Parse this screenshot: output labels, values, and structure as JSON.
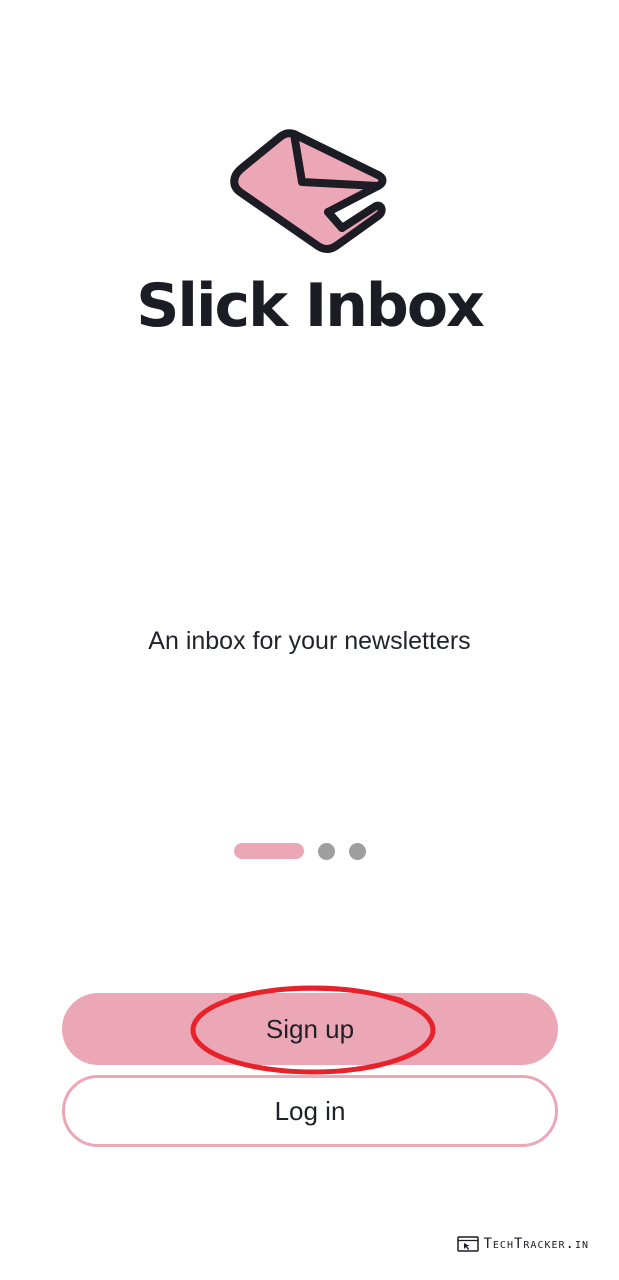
{
  "brand": {
    "name": "Slick Inbox",
    "logo_icon": "envelope-newspaper-icon",
    "logo_fill": "#eca7b6",
    "logo_stroke": "#1c1c24"
  },
  "onboarding": {
    "tagline": "An inbox for your newsletters",
    "page_indicator": {
      "current": 1,
      "total": 3
    }
  },
  "actions": {
    "signup_label": "Sign up",
    "login_label": "Log in"
  },
  "annotation": {
    "highlight_color": "#e8222a"
  },
  "watermark": {
    "text": "TechTracker.in",
    "icon": "browser-cursor-icon"
  },
  "colors": {
    "accent": "#eca7b6",
    "text": "#1c1c24",
    "inactive_dot": "#9e9e9e"
  }
}
